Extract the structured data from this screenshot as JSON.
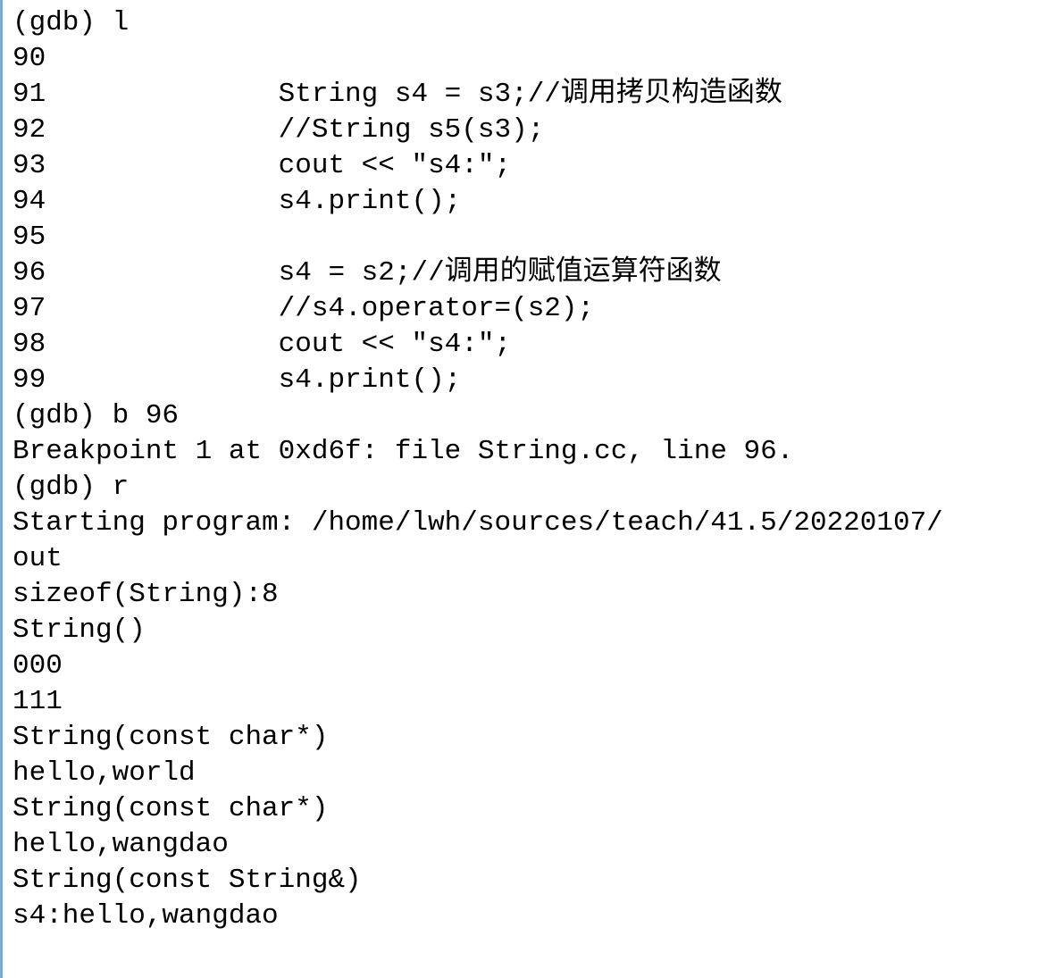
{
  "terminal": {
    "lines": [
      "(gdb) l",
      "90",
      "91              String s4 = s3;//调用拷贝构造函数",
      "92              //String s5(s3);",
      "93              cout << \"s4:\";",
      "94              s4.print();",
      "95",
      "96              s4 = s2;//调用的赋值运算符函数",
      "97              //s4.operator=(s2);",
      "98              cout << \"s4:\";",
      "99              s4.print();",
      "(gdb) b 96",
      "Breakpoint 1 at 0xd6f: file String.cc, line 96.",
      "(gdb) r",
      "Starting program: /home/lwh/sources/teach/41.5/20220107/",
      "out",
      "sizeof(String):8",
      "String()",
      "000",
      "111",
      "String(const char*)",
      "hello,world",
      "String(const char*)",
      "hello,wangdao",
      "String(const String&)",
      "s4:hello,wangdao"
    ]
  }
}
